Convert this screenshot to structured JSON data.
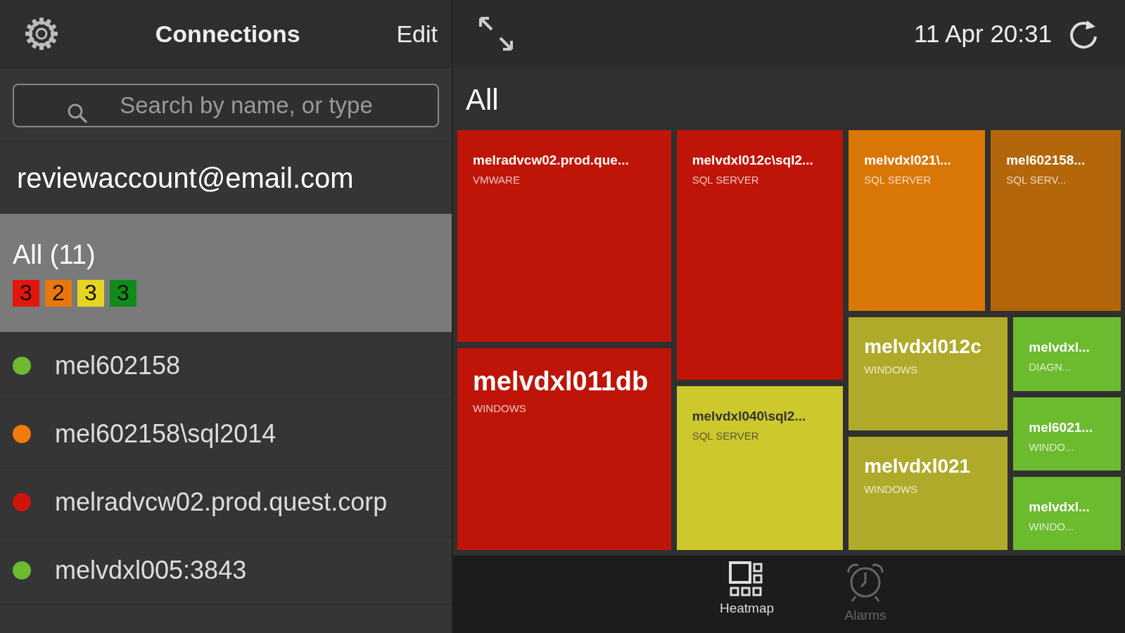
{
  "sidebar": {
    "title": "Connections",
    "edit": "Edit",
    "search": {
      "placeholder": "Search by name, or type"
    },
    "account": "reviewaccount@email.com",
    "group": {
      "label": "All (11)",
      "selected": true,
      "counts": [
        {
          "value": "3",
          "color": "#e3150d"
        },
        {
          "value": "2",
          "color": "#e8780c"
        },
        {
          "value": "3",
          "color": "#e6d520"
        },
        {
          "value": "3",
          "color": "#118a1c"
        }
      ]
    },
    "items": [
      {
        "name": "mel602158",
        "color": "#6cbb2f"
      },
      {
        "name": "mel602158\\sql2014",
        "color": "#f07c0c"
      },
      {
        "name": "melradvcw02.prod.quest.corp",
        "color": "#d0140a"
      },
      {
        "name": "melvdxl005:3843",
        "color": "#6cbb2f"
      }
    ]
  },
  "header": {
    "timestamp": "11 Apr 20:31",
    "title": "All"
  },
  "heatmap": {
    "columns": [
      {
        "tiles": [
          {
            "name": "melradvcw02.prod.que...",
            "type": "VMWARE",
            "color": "#bf1408"
          },
          {
            "name": "melvdxl011db",
            "type": "WINDOWS",
            "color": "#bf1408"
          }
        ]
      },
      {
        "tiles": [
          {
            "name": "melvdxl012c\\sql2...",
            "type": "SQL SERVER",
            "color": "#bf1408"
          },
          {
            "name": "melvdxl040\\sql2...",
            "type": "SQL SERVER",
            "color": "#cdc82c"
          }
        ]
      }
    ],
    "right_top": [
      {
        "name": "melvdxl021\\...",
        "type": "SQL SERVER",
        "color": "#d97706"
      },
      {
        "name": "mel602158...",
        "type": "SQL SERV...",
        "color": "#b3660a"
      }
    ],
    "right_bottom": [
      {
        "tiles": [
          {
            "name": "melvdxl012c",
            "type": "WINDOWS",
            "color": "#b0aa2a"
          },
          {
            "name": "melvdxl021",
            "type": "WINDOWS",
            "color": "#b0aa2a"
          }
        ]
      },
      {
        "tiles": [
          {
            "name": "melvdxl...",
            "type": "DIAGN...",
            "color": "#6cbb2f"
          },
          {
            "name": "mel6021...",
            "type": "WINDO...",
            "color": "#6cbb2f"
          },
          {
            "name": "melvdxl...",
            "type": "WINDO...",
            "color": "#6cbb2f"
          }
        ]
      }
    ]
  },
  "tabs": [
    {
      "label": "Heatmap",
      "selected": true,
      "kind": "heatmap"
    },
    {
      "label": "Alarms",
      "selected": false,
      "kind": "alarm"
    }
  ]
}
